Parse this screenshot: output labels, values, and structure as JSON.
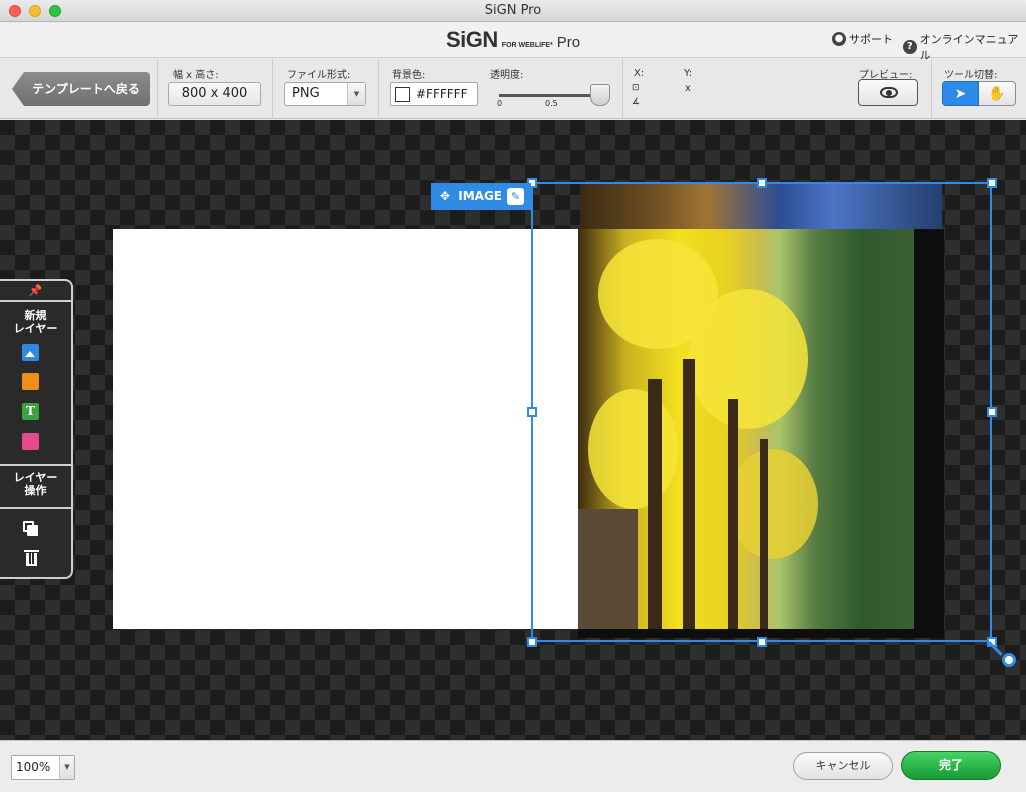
{
  "window": {
    "title": "SiGN Pro"
  },
  "header": {
    "logo_main": "SiGN",
    "logo_sub": "FOR WEBLIFE*",
    "logo_pro": "Pro",
    "support_label": "サポート",
    "manual_label": "オンラインマニュアル"
  },
  "toolbar": {
    "back_label": "テンプレートへ戻る",
    "size_label": "幅 x 高さ:",
    "size_value": "800 x 400",
    "format_label": "ファイル形式:",
    "format_value": "PNG",
    "bgcolor_label": "背景色:",
    "bgcolor_value": "#FFFFFF",
    "opacity_label": "透明度:",
    "opacity_tick_min": "0",
    "opacity_tick_mid": "0.5",
    "opacity_value": 1.0,
    "x_label": "X:",
    "y_label": "Y:",
    "size_sep": "x",
    "preview_label": "プレビュー:",
    "tool_label": "ツール切替:"
  },
  "selection": {
    "tag_label": "IMAGE"
  },
  "left_panel": {
    "new_layer_label_1": "新規",
    "new_layer_label_2": "レイヤー",
    "layer_ops_label_1": "レイヤー",
    "layer_ops_label_2": "操作"
  },
  "bottom": {
    "zoom_value": "100%",
    "cancel_label": "キャンセル",
    "done_label": "完了"
  },
  "colors": {
    "accent": "#2f8be4",
    "done_green": "#22b544",
    "image_layer": "#2e8ae0",
    "shape_layer": "#f08e1a",
    "text_layer": "#3aa33f",
    "table_layer": "#e8488d"
  }
}
